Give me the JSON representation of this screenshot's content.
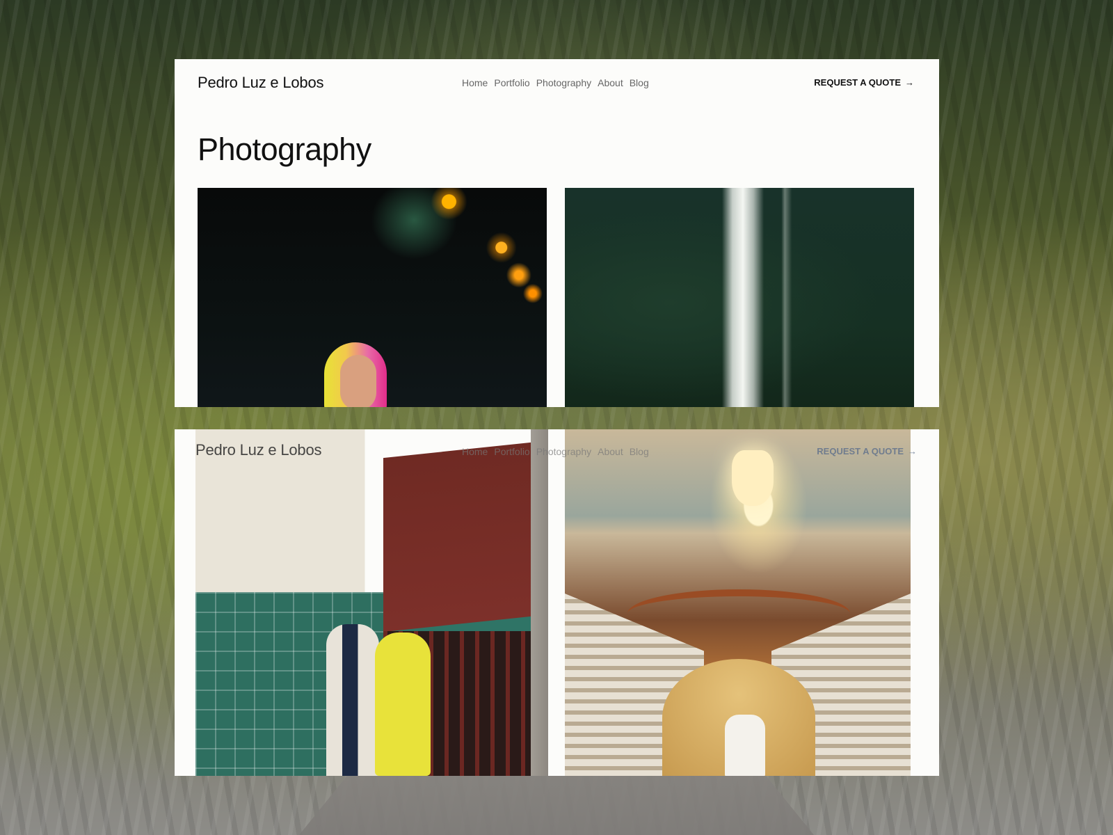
{
  "site": {
    "brand": "Pedro Luz e Lobos",
    "nav": [
      "Home",
      "Portfolio",
      "Photography",
      "About",
      "Blog"
    ],
    "cta": "REQUEST A QUOTE",
    "cta_icon": "arrow-right-icon"
  },
  "page": {
    "title": "Photography"
  },
  "gallery": {
    "photos": [
      {
        "id": "neon-portrait"
      },
      {
        "id": "waterfall"
      },
      {
        "id": "couple-tiles"
      },
      {
        "id": "staircase-bride"
      }
    ]
  },
  "colors": {
    "panel": "#fcfcfa",
    "text": "#111111",
    "nav_text": "#666666"
  }
}
